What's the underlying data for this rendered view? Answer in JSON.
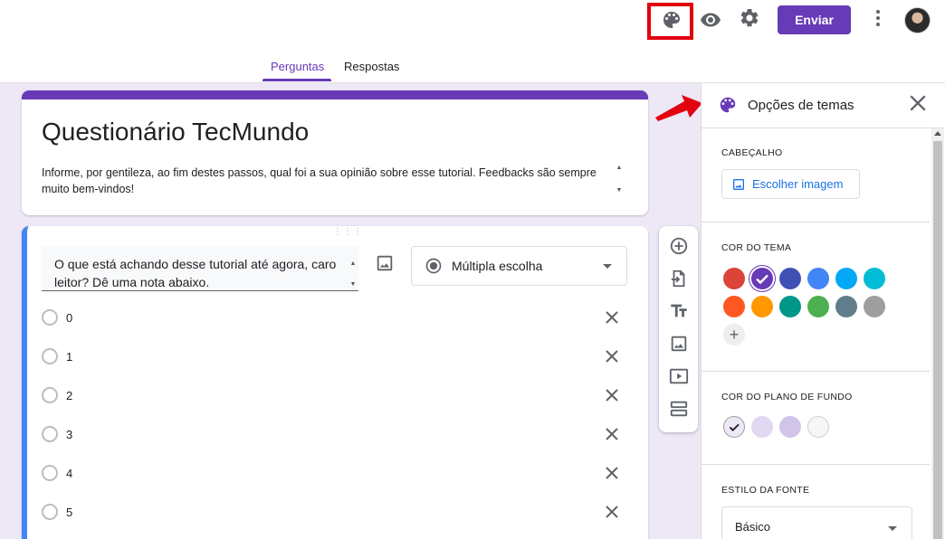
{
  "toolbar": {
    "send_label": "Enviar",
    "icons": [
      "palette-icon",
      "eye-icon",
      "gear-icon",
      "more-vert-icon"
    ]
  },
  "tabs": [
    {
      "label": "Perguntas",
      "active": true
    },
    {
      "label": "Respostas",
      "active": false
    }
  ],
  "form": {
    "title": "Questionário TecMundo",
    "description": "Informe, por gentileza, ao fim destes passos, qual foi a sua opinião sobre esse tutorial. Feedbacks são sempre muito bem-vindos!"
  },
  "question": {
    "text": "O que está achando desse tutorial até agora, caro leitor? Dê uma nota abaixo.",
    "type": "Múltipla escolha",
    "options": [
      "0",
      "1",
      "2",
      "3",
      "4",
      "5"
    ]
  },
  "panel": {
    "title": "Opções de temas",
    "header_label": "CABEÇALHO",
    "choose_image": "Escolher imagem",
    "theme_color_label": "COR DO TEMA",
    "theme_colors": [
      "#db4437",
      "#673ab7",
      "#3f51b5",
      "#4285f4",
      "#03a9f4",
      "#00bcd4",
      "#ff5722",
      "#ff9800",
      "#009688",
      "#4caf50",
      "#607d8b",
      "#9e9e9e"
    ],
    "selected_theme_color": "#673ab7",
    "bg_color_label": "COR DO PLANO DE FUNDO",
    "bg_colors": [
      "#ede7f6",
      "#e1d8f1",
      "#d1c4e9",
      "#f6f6f6"
    ],
    "font_style_label": "ESTILO DA FONTE",
    "font_style": "Básico"
  },
  "colors": {
    "accent": "#673ab7",
    "question_border": "#4285f4",
    "highlight": "#e3000f"
  }
}
